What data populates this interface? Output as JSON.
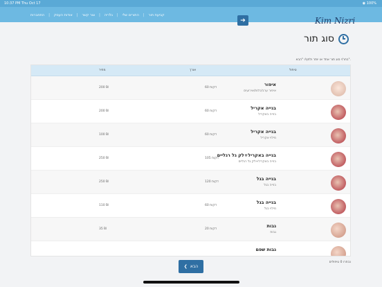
{
  "status": {
    "time": "10:37 PM  Thu Oct 17",
    "right": "◉ 100%"
  },
  "nav": {
    "links": [
      "התחברות",
      "אודות העסק",
      "צור קשר",
      "גלריה",
      "התורים שלי",
      "קביעת תור"
    ],
    "arrow": "➔",
    "logo": "Kim Nizri"
  },
  "page": {
    "title": "סוג תור",
    "instructions": "בחר/י סוג תור אחד או יותר ולחץ/י \"הבא\"."
  },
  "table": {
    "headers": {
      "treatment": "טיפול",
      "length": "אורך",
      "price": "מחיר"
    },
    "rows": [
      {
        "name": "איפור",
        "desc": "איפור ערב/כלות/אירועים",
        "length": "60 דקות",
        "price": "200 ₪"
      },
      {
        "name": "בנייה אקריל",
        "desc": "בנייה באקריל",
        "length": "60 דקות",
        "price": "200 ₪"
      },
      {
        "name": "בנייה אקריל",
        "desc": "מילוי אקריל",
        "length": "60 דקות",
        "price": "100 ₪"
      },
      {
        "name": "בנייה באקריל+לק גל רגליים",
        "desc": "בנייה באקריל+לק גל רגליים",
        "length": "105 דקות",
        "price": "250 ₪"
      },
      {
        "name": "בנייה בגל",
        "desc": "בנייה בגל",
        "length": "120 דקות",
        "price": "250 ₪"
      },
      {
        "name": "בנייה בגל",
        "desc": "מילוי בגל",
        "length": "60 דקות",
        "price": "110 ₪"
      },
      {
        "name": "גבות",
        "desc": "גבות",
        "length": "20 דקות",
        "price": "35 ₪"
      },
      {
        "name": "גבות שפם",
        "desc": "",
        "length": "",
        "price": ""
      }
    ],
    "thumbs": [
      "face",
      "nails",
      "nails",
      "nails",
      "nails",
      "nails",
      "hand",
      "hand"
    ]
  },
  "footer": {
    "selected_count": "נבחרו 0 טיפולים",
    "next_label": "הבא",
    "next_icon": "❮"
  }
}
